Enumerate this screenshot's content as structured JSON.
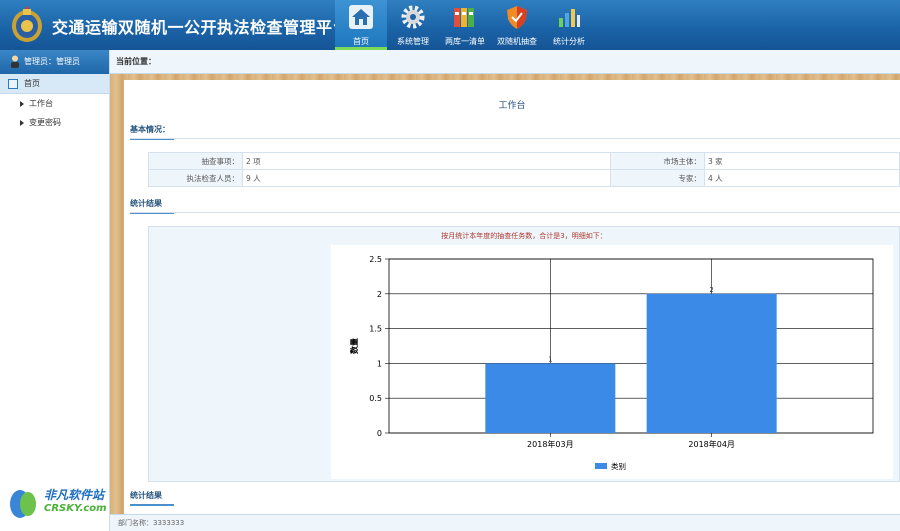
{
  "app": {
    "title": "交通运输双随机一公开执法检查管理平台"
  },
  "nav": [
    {
      "label": "首页",
      "icon": "home-icon",
      "active": true
    },
    {
      "label": "系统管理",
      "icon": "gear-icon",
      "active": false
    },
    {
      "label": "两库一清单",
      "icon": "binders-icon",
      "active": false
    },
    {
      "label": "双随机抽查",
      "icon": "shield-icon",
      "active": false
    },
    {
      "label": "统计分析",
      "icon": "bar-chart-icon",
      "active": false
    }
  ],
  "sidebar": {
    "admin_label": "管理员：管理员",
    "home_label": "首页",
    "items": [
      {
        "label": "工作台"
      },
      {
        "label": "变更密码"
      }
    ]
  },
  "breadcrumb": {
    "label": "当前位置："
  },
  "main": {
    "title": "工作台",
    "basic_section": "基本情况：",
    "info": {
      "check_items_label": "抽查事项：",
      "check_items_value": "2 项",
      "market_label": "市场主体：",
      "market_value": "3 家",
      "inspectors_label": "执法检查人员：",
      "inspectors_value": "9 人",
      "experts_label": "专家：",
      "experts_value": "4 人"
    },
    "stats_section": "统计结果",
    "stats_section_2": "统计结果",
    "stats_caption": "按月统计本年度的抽查任务数，合计是3，明细如下："
  },
  "chart_data": {
    "type": "bar",
    "categories": [
      "2018年03月",
      "2018年04月"
    ],
    "series": [
      {
        "name": "类别",
        "values": [
          1,
          2
        ]
      }
    ],
    "data_labels": [
      "1",
      "2"
    ],
    "ylabel": "数量",
    "ylim": [
      0,
      2.5
    ],
    "yticks": [
      "0",
      "0.5",
      "1",
      "1.5",
      "2",
      "2.5"
    ],
    "grid": true,
    "legend": "bottom",
    "color": "#3c8ae8"
  },
  "footer": {
    "label": "部门名称：3333333"
  },
  "watermark": {
    "text": "非凡软件站",
    "sub": "CRSKY.com"
  },
  "colors": {
    "header": "#1b64a8",
    "accent": "#4b8fcc",
    "bar": "#3c8ae8"
  }
}
